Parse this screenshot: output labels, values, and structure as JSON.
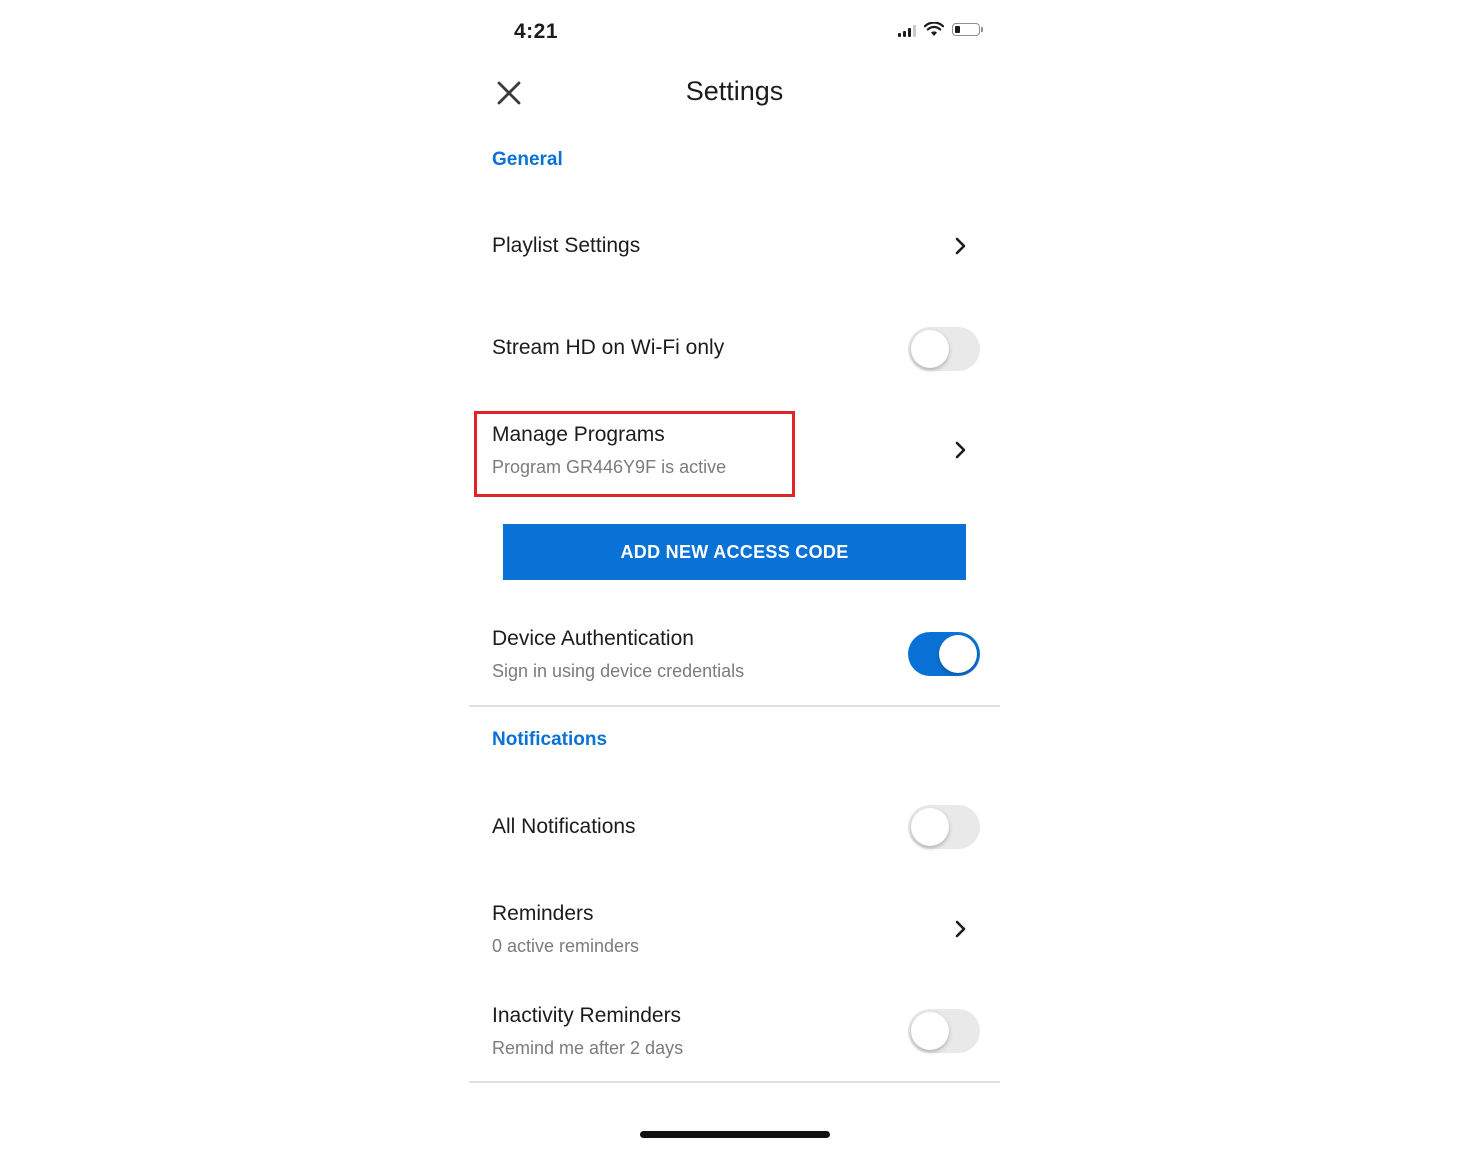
{
  "status_bar": {
    "time": "4:21",
    "icons": [
      "signal-icon",
      "wifi-icon",
      "battery-icon"
    ]
  },
  "header": {
    "title": "Settings",
    "close_icon": "close-icon"
  },
  "sections": {
    "general": {
      "label": "General",
      "playlist_settings": {
        "title": "Playlist Settings"
      },
      "stream_hd": {
        "title": "Stream HD on Wi-Fi only",
        "enabled": false
      },
      "manage_programs": {
        "title": "Manage Programs",
        "subtitle": "Program GR446Y9F is active"
      },
      "add_access_code": {
        "label": "ADD NEW ACCESS CODE"
      },
      "device_auth": {
        "title": "Device Authentication",
        "subtitle": "Sign in using device credentials",
        "enabled": true
      }
    },
    "notifications": {
      "label": "Notifications",
      "all_notifications": {
        "title": "All Notifications",
        "enabled": false
      },
      "reminders": {
        "title": "Reminders",
        "subtitle": "0 active reminders"
      },
      "inactivity": {
        "title": "Inactivity Reminders",
        "subtitle": "Remind me after 2 days",
        "enabled": false
      }
    }
  },
  "colors": {
    "accent": "#0a72d6",
    "highlight": "#e0242b",
    "toggle_off": "#e9e9ea",
    "secondary_text": "#7b7b80"
  }
}
